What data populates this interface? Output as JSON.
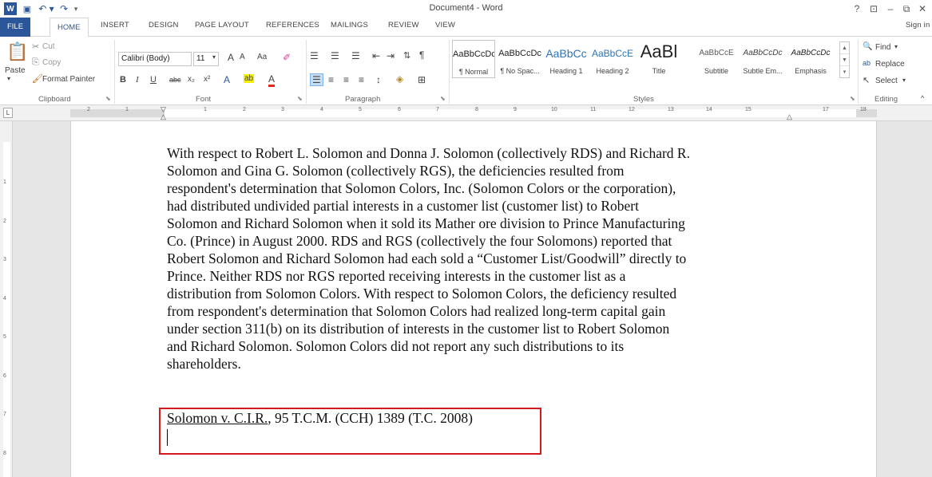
{
  "window": {
    "title": "Document4 - Word",
    "help": "?",
    "ribbon_display": "⊡",
    "minimize": "–",
    "restore": "⧉",
    "close": "✕",
    "sign_in": "Sign in"
  },
  "quick_access": {
    "word": "W",
    "save": "💾",
    "undo": "↶ ▾",
    "redo": "↷",
    "customize": "▾"
  },
  "tabs": [
    {
      "label": "FILE"
    },
    {
      "label": "HOME"
    },
    {
      "label": "INSERT"
    },
    {
      "label": "DESIGN"
    },
    {
      "label": "PAGE LAYOUT"
    },
    {
      "label": "REFERENCES"
    },
    {
      "label": "MAILINGS"
    },
    {
      "label": "REVIEW"
    },
    {
      "label": "VIEW"
    }
  ],
  "clipboard": {
    "paste": "Paste",
    "cut": "Cut",
    "copy": "Copy",
    "format_painter": "Format Painter",
    "label": "Clipboard"
  },
  "font": {
    "family": "Calibri (Body)",
    "size": "11",
    "grow": "A",
    "shrink": "A",
    "change_case": "Aa",
    "bold": "B",
    "italic": "I",
    "underline": "U",
    "strikethrough": "abc",
    "subscript": "x₂",
    "superscript": "x²",
    "text_effects": "A",
    "highlight": "ab",
    "font_color": "A",
    "label": "Font"
  },
  "paragraph": {
    "label": "Paragraph"
  },
  "styles": {
    "label": "Styles",
    "items": [
      {
        "preview": "AaBbCcDc",
        "name": "¶ Normal"
      },
      {
        "preview": "AaBbCcDc",
        "name": "¶ No Spac..."
      },
      {
        "preview": "AaBbCc",
        "name": "Heading 1"
      },
      {
        "preview": "AaBbCcE",
        "name": "Heading 2"
      },
      {
        "preview": "AaBl",
        "name": "Title"
      },
      {
        "preview": "AaBbCcE",
        "name": "Subtitle"
      },
      {
        "preview": "AaBbCcDc",
        "name": "Subtle Em..."
      },
      {
        "preview": "AaBbCcDc",
        "name": "Emphasis"
      }
    ]
  },
  "editing": {
    "find": "Find",
    "replace": "Replace",
    "select": "Select",
    "label": "Editing"
  },
  "ruler": {
    "h_ticks": [
      "2",
      "1",
      "1",
      "2",
      "3",
      "4",
      "5",
      "6",
      "7",
      "8",
      "9",
      "10",
      "11",
      "12",
      "13",
      "14",
      "15",
      "17",
      "18"
    ],
    "v_ticks": [
      "1",
      "2",
      "3",
      "4",
      "5",
      "6",
      "7",
      "8"
    ]
  },
  "document": {
    "lines": [
      "With respect to Robert L. Solomon and Donna J. Solomon (collectively RDS) and Richard R.",
      "Solomon and Gina G. Solomon (collectively RGS), the deficiencies resulted from",
      "respondent's determination that Solomon Colors, Inc. (Solomon Colors or the corporation),",
      "had distributed undivided partial interests in a customer list (customer list) to Robert",
      "Solomon and Richard Solomon when it sold its Mather ore division to Prince Manufacturing",
      "Co. (Prince) in August 2000. RDS and RGS (collectively the four Solomons) reported that",
      "Robert Solomon and Richard Solomon had each sold a “Customer List/Goodwill” directly to",
      "Prince. Neither RDS nor RGS reported receiving interests in the customer list as a",
      "distribution from Solomon Colors. With respect to Solomon Colors, the deficiency resulted",
      "from respondent's determination that Solomon Colors had realized long-term capital gain",
      "under section 311(b) on its distribution of interests in the customer list to Robert Solomon",
      "and Richard Solomon. Solomon Colors did not report any such distributions to its",
      "shareholders."
    ],
    "citation_case": "Solomon v. C.I.R.",
    "citation_rest": ", 95 T.C.M. (CCH) 1389 (T.C. 2008)",
    "highlight_color": "#d2191e"
  },
  "colors": {
    "accent": "#2b579a"
  }
}
